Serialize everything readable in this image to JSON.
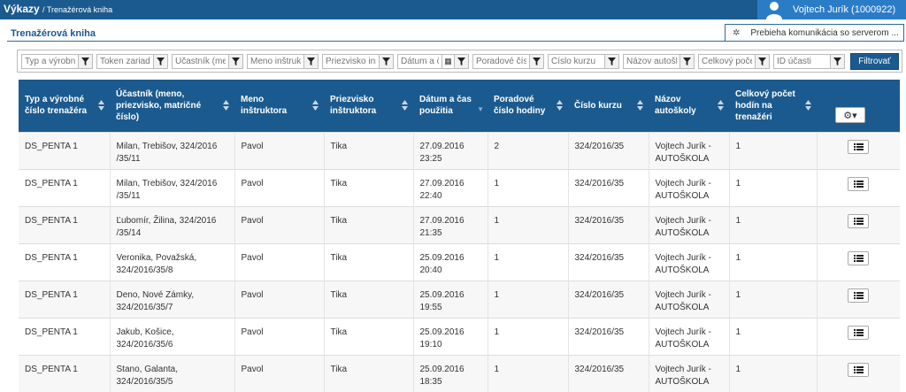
{
  "header": {
    "app_name": "Výkazy",
    "breadcrumb": "/ Trenažérová kniha",
    "user": "Vojtech Jurík (1000922)"
  },
  "page_title": "Trenažérová kniha",
  "notice": "Prebieha komunikácia so serverom ...",
  "filters": {
    "placeholders": [
      "Typ a výrobné",
      "Token zariade",
      "Účastník (me",
      "Meno inštrukt",
      "Priezvisko inš",
      "Dátum a čas",
      "Poradové čísl",
      "Číslo kurzu",
      "Názov autošk",
      "Celkový poče",
      "ID účasti"
    ],
    "submit": "Filtrovať"
  },
  "table": {
    "columns": [
      "Typ a výrobné číslo trenažéra",
      "Účastník (meno, priezvisko, matričné číslo)",
      "Meno inštruktora",
      "Priezvisko inštruktora",
      "Dátum a čas použitia",
      "Poradové číslo hodiny",
      "Číslo kurzu",
      "Názov autoškoly",
      "Celkový počet hodín na trenažéri"
    ],
    "rows": [
      {
        "type": "DS_PENTA 1",
        "participant": "Milan, Trebišov, 324/2016 /35/11",
        "first": "Pavol",
        "last": "Tika",
        "date": "27.09.2016",
        "time": "23:25",
        "lesson": "2",
        "course": "324/2016/35",
        "school": "Vojtech Jurík - AUTOŠKOLA",
        "total": "1"
      },
      {
        "type": "DS_PENTA 1",
        "participant": "Milan, Trebišov, 324/2016 /35/11",
        "first": "Pavol",
        "last": "Tika",
        "date": "27.09.2016",
        "time": "22:40",
        "lesson": "1",
        "course": "324/2016/35",
        "school": "Vojtech Jurík - AUTOŠKOLA",
        "total": "1"
      },
      {
        "type": "DS_PENTA 1",
        "participant": "Ľubomír, Žilina, 324/2016 /35/14",
        "first": "Pavol",
        "last": "Tika",
        "date": "27.09.2016",
        "time": "21:35",
        "lesson": "1",
        "course": "324/2016/35",
        "school": "Vojtech Jurík - AUTOŠKOLA",
        "total": "1"
      },
      {
        "type": "DS_PENTA 1",
        "participant": "Veronika, Považská, 324/2016/35/8",
        "first": "Pavol",
        "last": "Tika",
        "date": "25.09.2016",
        "time": "20:40",
        "lesson": "1",
        "course": "324/2016/35",
        "school": "Vojtech Jurík - AUTOŠKOLA",
        "total": "1"
      },
      {
        "type": "DS_PENTA 1",
        "participant": "Deno, Nové Zámky, 324/2016/35/7",
        "first": "Pavol",
        "last": "Tika",
        "date": "25.09.2016",
        "time": "19:55",
        "lesson": "1",
        "course": "324/2016/35",
        "school": "Vojtech Jurík - AUTOŠKOLA",
        "total": "1"
      },
      {
        "type": "DS_PENTA 1",
        "participant": "Jakub, Košice, 324/2016/35/6",
        "first": "Pavol",
        "last": "Tika",
        "date": "25.09.2016",
        "time": "19:10",
        "lesson": "1",
        "course": "324/2016/35",
        "school": "Vojtech Jurík - AUTOŠKOLA",
        "total": "1"
      },
      {
        "type": "DS_PENTA 1",
        "participant": "Stano, Galanta, 324/2016/35/5",
        "first": "Pavol",
        "last": "Tika",
        "date": "25.09.2016",
        "time": "18:35",
        "lesson": "1",
        "course": "324/2016/35",
        "school": "Vojtech Jurík - AUTOŠKOLA",
        "total": "1"
      }
    ]
  },
  "icons": {
    "user": "user-icon",
    "filter": "filter-funnel-icon",
    "calendar": "calendar-icon",
    "gear": "gear-icon",
    "row_action": "list-icon",
    "sort": "sort-arrows-icon",
    "spinner": "spinner-icon"
  },
  "colors": {
    "header_blue": "#1b5a8e",
    "user_blue": "#2b7cc7"
  }
}
